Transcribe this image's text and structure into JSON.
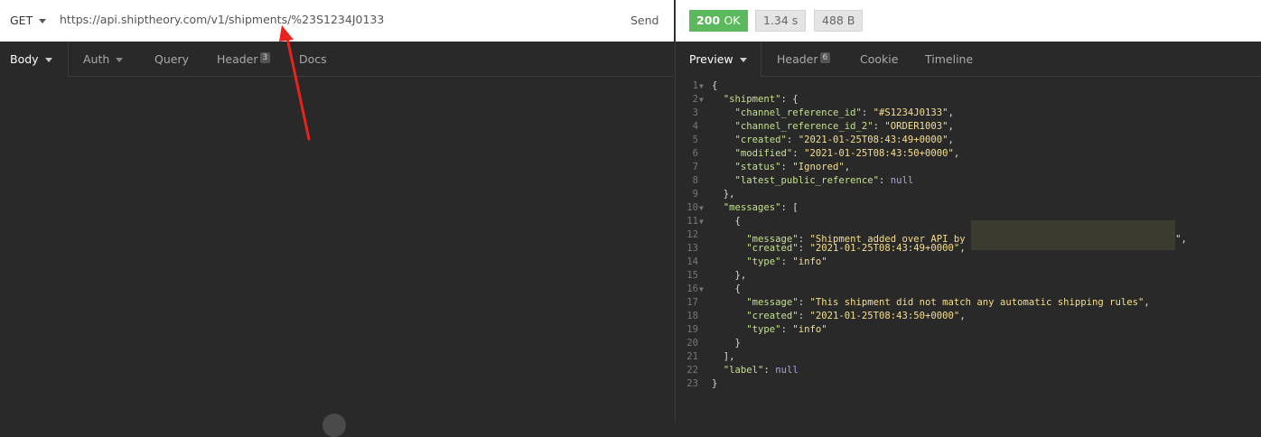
{
  "request": {
    "method": "GET",
    "url": "https://api.shiptheory.com/v1/shipments/%23S1234J0133",
    "send_label": "Send",
    "tabs": [
      {
        "label": "Body",
        "badge": ""
      },
      {
        "label": "Auth",
        "badge": ""
      },
      {
        "label": "Query",
        "badge": ""
      },
      {
        "label": "Header",
        "badge": "3"
      },
      {
        "label": "Docs",
        "badge": ""
      }
    ]
  },
  "response": {
    "status_code": "200",
    "status_text": "OK",
    "time": "1.34 s",
    "size": "488 B",
    "tabs": [
      {
        "label": "Preview",
        "badge": ""
      },
      {
        "label": "Header",
        "badge": "6"
      },
      {
        "label": "Cookie",
        "badge": ""
      },
      {
        "label": "Timeline",
        "badge": ""
      }
    ],
    "json": {
      "shipment": {
        "channel_reference_id": "#S1234J0133",
        "channel_reference_id_2": "ORDER1003",
        "created": "2021-01-25T08:43:49+0000",
        "modified": "2021-01-25T08:43:50+0000",
        "status": "Ignored",
        "latest_public_reference": "null"
      },
      "messages": [
        {
          "message": "Shipment added over API by ",
          "created": "2021-01-25T08:43:49+0000",
          "type": "info"
        },
        {
          "message": "This shipment did not match any automatic shipping rules",
          "created": "2021-01-25T08:43:50+0000",
          "type": "info"
        }
      ],
      "label": "null"
    },
    "line_numbers": [
      "1",
      "2",
      "3",
      "4",
      "5",
      "6",
      "7",
      "8",
      "9",
      "10",
      "11",
      "12",
      "13",
      "14",
      "15",
      "16",
      "17",
      "18",
      "19",
      "20",
      "21",
      "22",
      "23"
    ]
  },
  "colors": {
    "status_ok": "#5cb85c",
    "json_key": "#c4e08f",
    "json_string": "#f7df8f",
    "json_null": "#b39ddb",
    "annotation_arrow": "#e8221c"
  }
}
